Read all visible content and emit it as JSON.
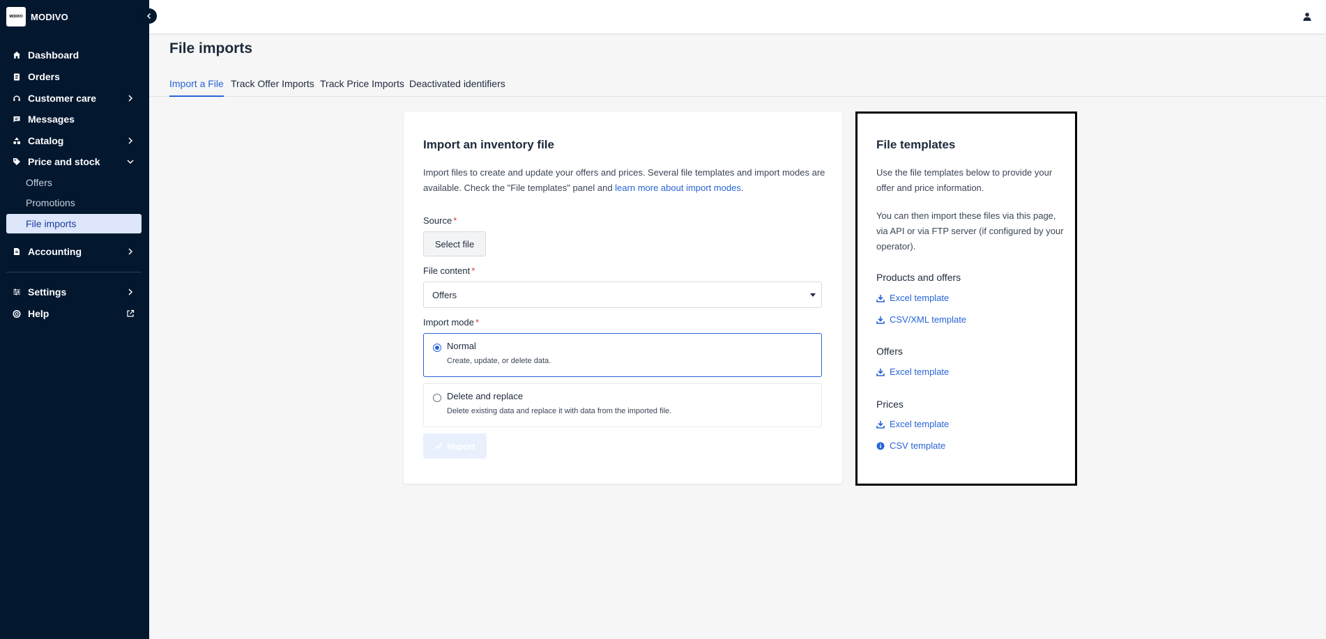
{
  "brand": {
    "logo_text": "MODIVO",
    "name": "MODIVO"
  },
  "sidebar": {
    "items": [
      {
        "label": "Dashboard",
        "icon": "home-icon"
      },
      {
        "label": "Orders",
        "icon": "clipboard-icon"
      },
      {
        "label": "Customer care",
        "icon": "headset-icon",
        "chevron": "right"
      },
      {
        "label": "Messages",
        "icon": "message-icon"
      },
      {
        "label": "Catalog",
        "icon": "shapes-icon",
        "chevron": "right"
      },
      {
        "label": "Price and stock",
        "icon": "tag-icon",
        "chevron": "down"
      },
      {
        "label": "Accounting",
        "icon": "document-icon",
        "chevron": "right"
      },
      {
        "label": "Settings",
        "icon": "sliders-icon",
        "chevron": "right"
      },
      {
        "label": "Help",
        "icon": "lifebuoy-icon",
        "external": true
      }
    ],
    "subitems": [
      {
        "label": "Offers"
      },
      {
        "label": "Promotions"
      },
      {
        "label": "File imports",
        "active": true
      }
    ]
  },
  "page": {
    "title": "File imports"
  },
  "tabs": [
    {
      "label": "Import a File",
      "active": true
    },
    {
      "label": "Track Offer Imports"
    },
    {
      "label": "Track Price Imports"
    },
    {
      "label": "Deactivated identifiers"
    }
  ],
  "import_card": {
    "title": "Import an inventory file",
    "description": "Import files to create and update your offers and prices. Several file templates and import modes are available. Check the \"File templates\" panel and ",
    "description_link": "learn more about import modes",
    "description_end": ".",
    "source_label": "Source",
    "select_file": "Select file",
    "file_content_label": "File content",
    "file_content_value": "Offers",
    "import_mode_label": "Import mode",
    "modes": [
      {
        "title": "Normal",
        "desc": "Create, update, or delete data.",
        "selected": true
      },
      {
        "title": "Delete and replace",
        "desc": "Delete existing data and replace it with data from the imported file.",
        "selected": false
      }
    ],
    "import_button": "Import",
    "required_mark": "*"
  },
  "templates_card": {
    "title": "File templates",
    "intro1": "Use the file templates below to provide your offer and price information.",
    "intro2": "You can then import these files via this page, via API or via FTP server (if configured by your operator).",
    "sections": [
      {
        "title": "Products and offers",
        "links": [
          "Excel template",
          "CSV/XML template"
        ]
      },
      {
        "title": "Offers",
        "links": [
          "Excel template"
        ]
      },
      {
        "title": "Prices",
        "links": [
          "Excel template",
          "CSV template"
        ]
      }
    ]
  },
  "colors": {
    "sidebar_bg": "#03172f",
    "accent": "#2764d8",
    "active_nav_bg": "#dde6fb",
    "required": "#d83a3a"
  }
}
